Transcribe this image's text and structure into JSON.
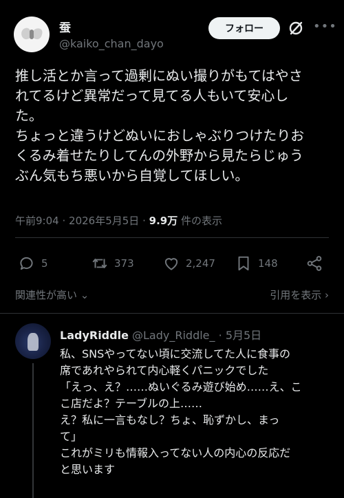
{
  "post": {
    "author_name": "蚕",
    "author_handle": "@kaiko_chan_dayo",
    "follow_label": "フォロー",
    "more_icon": "more-icon",
    "text": "推し活とか言って過剰にぬい撮りがもてはやさ\nれてるけど異常だって見てる人もいて安心し\nた。\nちょっと違うけどぬいにおしゃぶりつけたりお\nくるみ着せたりしてんの外野から見たらじゅう\nぶん気もち悪いから自覚してほしい。",
    "time": "午前9:04",
    "date": "2026年5月5日",
    "separator": "·",
    "views_count": "9.9万",
    "views_label": "件の表示",
    "stats": {
      "replies": "5",
      "reposts": "373",
      "likes": "2,247",
      "bookmarks": "148"
    },
    "related_label": "関連性が高い",
    "quote_label": "引用を表示"
  },
  "reply": {
    "author_name": "LadyRiddle",
    "author_handle": "@Lady_Riddle_",
    "date": "5月5日",
    "separator": "·",
    "text": "私、SNSやってない頃に交流してた人に食事の\n席であれやられて内心軽くパニックでした\n「えっ、え？……ぬいぐるみ遊び始め……え、こ\nこ店だよ？テーブルの上……\nえ？私に一言もなし？ちょ、恥ずかし、まっ\nて」\nこれがミリも情報入ってない人の内心の反応だ\nと思います"
  }
}
